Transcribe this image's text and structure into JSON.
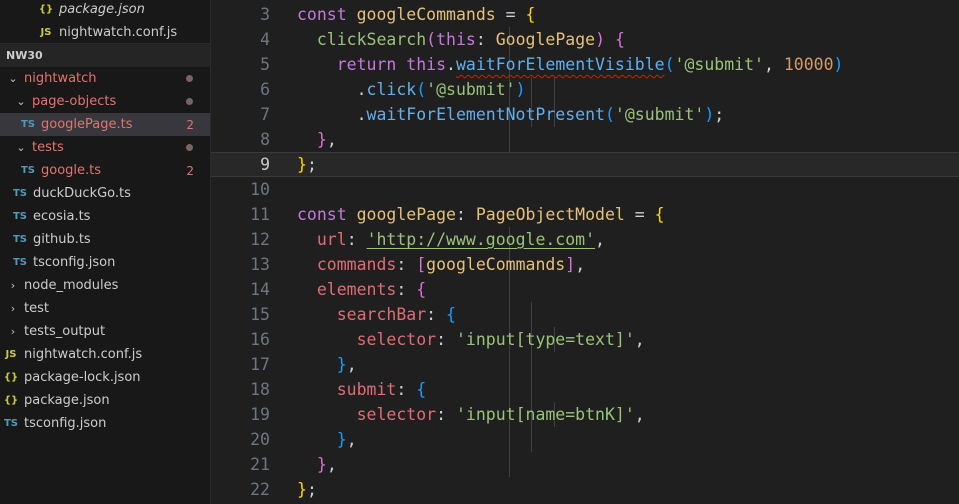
{
  "explorer": {
    "top_files": [
      {
        "label": "package.json",
        "icon": "{}"
      },
      {
        "label": "nightwatch.conf.js",
        "icon": "JS"
      }
    ],
    "section_title": "NW30",
    "tree": [
      {
        "label": "nightwatch",
        "kind": "folder"
      },
      {
        "label": "page-objects",
        "kind": "folder"
      },
      {
        "label": "googlePage.ts",
        "kind": "file",
        "icon": "TS",
        "badge": "2"
      },
      {
        "label": "tests",
        "kind": "folder"
      },
      {
        "label": "google.ts",
        "kind": "file",
        "icon": "TS",
        "badge": "2"
      },
      {
        "label": "duckDuckGo.ts",
        "kind": "file",
        "icon": "TS"
      },
      {
        "label": "ecosia.ts",
        "kind": "file",
        "icon": "TS"
      },
      {
        "label": "github.ts",
        "kind": "file",
        "icon": "TS"
      },
      {
        "label": "tsconfig.json",
        "kind": "file",
        "icon": "TS"
      },
      {
        "label": "node_modules",
        "kind": "folder"
      },
      {
        "label": "test",
        "kind": "folder"
      },
      {
        "label": "tests_output",
        "kind": "folder"
      },
      {
        "label": "nightwatch.conf.js",
        "kind": "file",
        "icon": "JS"
      },
      {
        "label": "package-lock.json",
        "kind": "file",
        "icon": "{}"
      },
      {
        "label": "package.json",
        "kind": "file",
        "icon": "{}"
      },
      {
        "label": "tsconfig.json",
        "kind": "file",
        "icon": "TS"
      }
    ]
  },
  "editor": {
    "line_numbers": [
      "3",
      "4",
      "5",
      "6",
      "7",
      "8",
      "9",
      "10",
      "11",
      "12",
      "13",
      "14",
      "15",
      "16",
      "17",
      "18",
      "19",
      "20",
      "21",
      "22"
    ],
    "tokens": {
      "const": "const",
      "googleCommands": "googleCommands",
      "eq_brace": " = {",
      "clickSearch": "clickSearch",
      "this_kw": "this",
      "GooglePage": "GooglePage",
      "return": "return",
      "waitForElementVisible": "waitForElementVisible",
      "submit_sel": "'@submit'",
      "timeout": "10000",
      "click": "click",
      "waitForElementNotPresent": "waitForElementNotPresent",
      "googlePage": "googlePage",
      "PageObjectModel": "PageObjectModel",
      "url_key": "url",
      "url_val": "'http://www.google.com'",
      "commands_key": "commands",
      "elements_key": "elements",
      "searchBar_key": "searchBar",
      "selector_key": "selector",
      "sel_text": "'input[type=text]'",
      "submit_key": "submit",
      "sel_btn": "'input[name=btnK]'"
    }
  }
}
